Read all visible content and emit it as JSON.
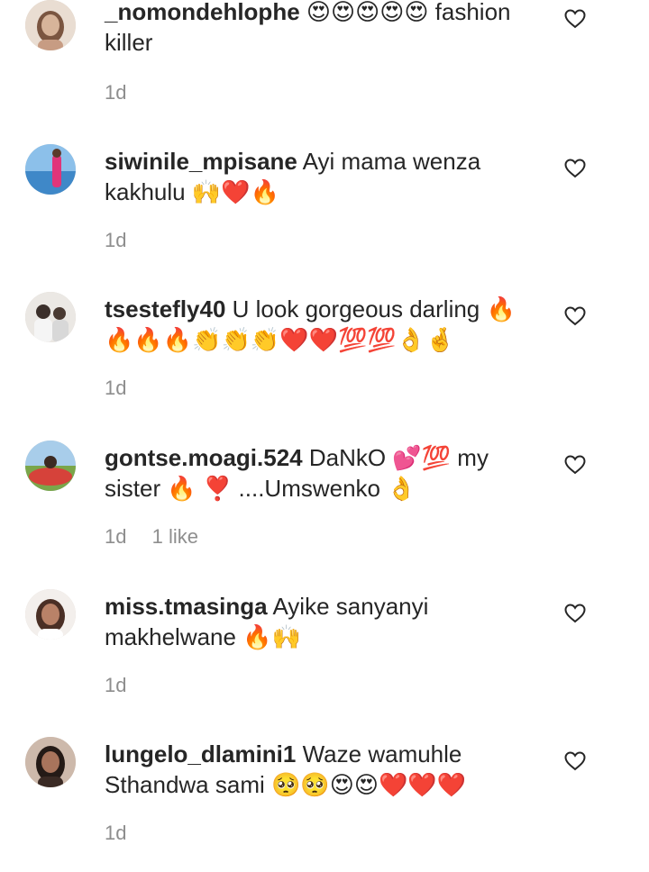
{
  "comments": [
    {
      "username": "_nomondehlophe",
      "text": "😍😍😍😍😍 fashion killer",
      "time": "1d",
      "likes": "",
      "avatar_icon": "woman-portrait-avatar",
      "avatar_colors": [
        "#d7b49a",
        "#6b4a36"
      ]
    },
    {
      "username": "siwinile_mpisane",
      "text": "Ayi mama wenza kakhulu 🙌❤️🔥",
      "time": "1d",
      "likes": "",
      "avatar_icon": "beach-photo-avatar",
      "avatar_colors": [
        "#7fb7e6",
        "#e0357a"
      ]
    },
    {
      "username": "tsestefly40",
      "text": "U look gorgeous darling 🔥🔥🔥🔥👏👏👏❤️❤️💯💯👌🤞",
      "time": "1d",
      "likes": "",
      "avatar_icon": "group-photo-avatar",
      "avatar_colors": [
        "#e8e6e2",
        "#3b2f2a"
      ]
    },
    {
      "username": "gontse.moagi.524",
      "text": "DaNkO 💕💯 my sister 🔥 ❣️ ....Umswenko 👌",
      "time": "1d",
      "likes": "1 like",
      "avatar_icon": "car-photo-avatar",
      "avatar_colors": [
        "#9ec7e8",
        "#d6423a"
      ]
    },
    {
      "username": "miss.tmasinga",
      "text": "Ayike sanyanyi makhelwane 🔥🙌",
      "time": "1d",
      "likes": "",
      "avatar_icon": "woman-portrait-avatar",
      "avatar_colors": [
        "#f1ece8",
        "#4a2f25"
      ]
    },
    {
      "username": "lungelo_dlamini1",
      "text": "Waze wamuhle Sthandwa sami 🥺🥺😍😍❤️❤️❤️",
      "time": "1d",
      "likes": "",
      "avatar_icon": "woman-portrait-avatar",
      "avatar_colors": [
        "#c9b2a3",
        "#241a16"
      ]
    }
  ],
  "colors": {
    "text": "#262626",
    "meta": "#8e8e8e",
    "heart_outline": "#262626"
  },
  "icons": {
    "like": "heart-outline-icon"
  }
}
